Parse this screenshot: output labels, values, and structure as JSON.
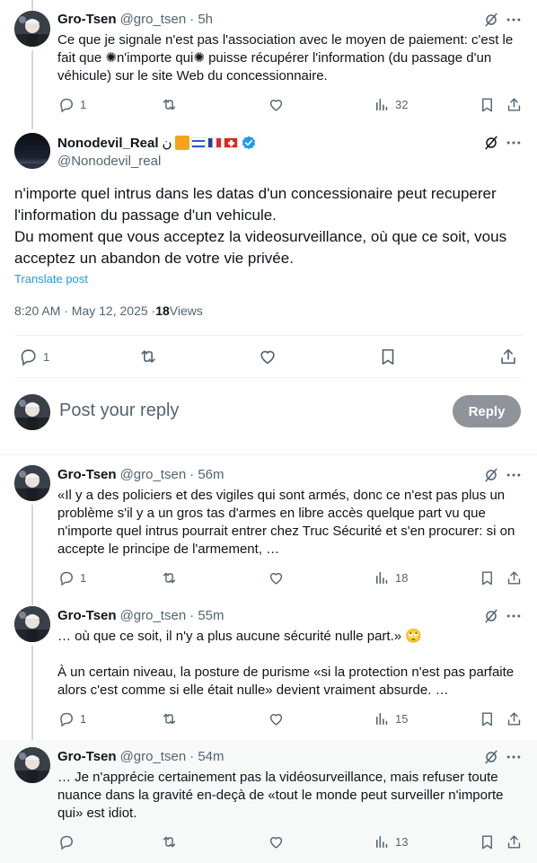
{
  "tweets_before": [
    {
      "name": "Gro-Tsen",
      "handle": "@gro_tsen",
      "time": "· 5h",
      "text": "Ce que je signale n'est pas l'association avec le moyen de paiement: c'est le fait que ✺n'importe qui✺ puisse récupérer l'information (du passage d'un véhicule) sur le site Web du concessionnaire.",
      "replies": "1",
      "views": "32"
    }
  ],
  "main_tweet": {
    "name": "Nonodevil_Real",
    "name_suffix": "ن",
    "handle": "@Nonodevil_real",
    "text": "n'importe quel intrus dans les datas d'un concessionaire peut recuperer l'information du passage d'un vehicule.\nDu moment que vous acceptez la videosurveillance, où que ce soit, vous acceptez un abandon de votre vie privée.",
    "translate": "Translate post",
    "timestamp": "8:20 AM · May 12, 2025 · ",
    "views_count": "18",
    "views_label": " Views",
    "replies": "1",
    "colors": {
      "verified": "#1d9bf0",
      "link": "#1d9bf0"
    }
  },
  "compose": {
    "placeholder": "Post your reply",
    "button": "Reply"
  },
  "replies": [
    {
      "name": "Gro-Tsen",
      "handle": "@gro_tsen",
      "time": "· 56m",
      "text": "«Il y a des policiers et des vigiles qui sont armés, donc ce n'est pas plus un problème s'il y a un gros tas d'armes en libre accès quelque part vu que n'importe quel intrus pourrait entrer chez Truc Sécurité et s'en procurer: si on accepte le principe de l'armement, …",
      "replies": "1",
      "views": "18"
    },
    {
      "name": "Gro-Tsen",
      "handle": "@gro_tsen",
      "time": "· 55m",
      "text": "… où que ce soit, il n'y a plus aucune sécurité nulle part.» 🙄\n\nÀ un certain niveau, la posture de purisme «si la protection n'est pas parfaite alors c'est comme si elle était nulle» devient vraiment absurde. …",
      "replies": "1",
      "views": "15"
    },
    {
      "name": "Gro-Tsen",
      "handle": "@gro_tsen",
      "time": "· 54m",
      "text": "… Je n'apprécie certainement pas la vidéosurveillance, mais refuser toute nuance dans la gravité en-deçà de «tout le monde peut surveiller n'importe qui» est idiot.",
      "replies": "",
      "views": "13"
    }
  ]
}
